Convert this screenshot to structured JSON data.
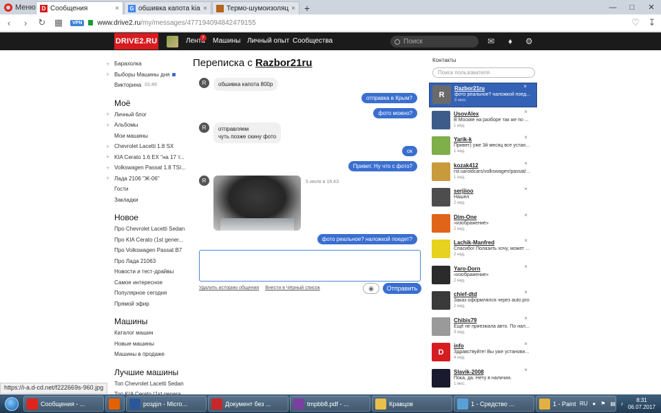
{
  "browser": {
    "menu_label": "Меню",
    "tabs": [
      {
        "label": "Сообщения",
        "active": true,
        "fav_color": "#d71c21",
        "fav_glyph": "D"
      },
      {
        "label": "обшивка капота kia cerato",
        "active": false,
        "fav_color": "#4285f4",
        "fav_glyph": "G"
      },
      {
        "label": "Термо-шумоизоляция ка",
        "active": false,
        "fav_color": "#b5651d",
        "fav_glyph": ""
      }
    ],
    "url_host": "www.drive2.ru",
    "url_path": "/my/messages/4771940948424791​55",
    "vpn_label": "VPN"
  },
  "site": {
    "logo": "DRIVE2.RU",
    "nav": [
      {
        "label": "Лента",
        "badge": "7"
      },
      {
        "label": "Машины"
      },
      {
        "label": "Личный опыт"
      },
      {
        "label": "Сообщества"
      }
    ],
    "search_placeholder": "Поиск"
  },
  "leftnav": {
    "top": [
      {
        "label": "Барахолка",
        "plus": true
      },
      {
        "label": "Выборы Машины дня",
        "plus": true,
        "dot": true
      },
      {
        "label": "Викторина",
        "time": "01:49"
      }
    ],
    "moe_title": "Моё",
    "moe": [
      {
        "label": "Личный блог",
        "plus": true
      },
      {
        "label": "Альбомы",
        "plus": true
      },
      {
        "label": "Мои машины"
      },
      {
        "label": "Chevrolet Lacetti 1.8 SX",
        "plus": true
      },
      {
        "label": "KIA Cerato 1.6 EX \"на 17 т...",
        "plus": true
      },
      {
        "label": "Volkswagen Passat 1.8 TSI...",
        "plus": true
      },
      {
        "label": "Лада 2106 \"Ж-06\"",
        "plus": true
      },
      {
        "label": "Гости"
      },
      {
        "label": "Закладки"
      }
    ],
    "new_title": "Новое",
    "new": [
      {
        "label": "Про Chevrolet Lacetti Sedan"
      },
      {
        "label": "Про KIA Cerato (1st gener..."
      },
      {
        "label": "Про Volkswagen Passat B7"
      },
      {
        "label": "Про Лада 21063"
      },
      {
        "label": "Новости и тест-драйвы"
      },
      {
        "label": "Самое интересное"
      },
      {
        "label": "Популярное сегодня"
      },
      {
        "label": "Прямой эфир"
      }
    ],
    "cars_title": "Машины",
    "cars": [
      {
        "label": "Каталог машин"
      },
      {
        "label": "Новые машины"
      },
      {
        "label": "Машины в продаже"
      }
    ],
    "best_title": "Лучшие машины",
    "best": [
      {
        "label": "Топ Chevrolet Lacetti Sedan"
      },
      {
        "label": "Топ KIA Cerato (1st genera..."
      }
    ]
  },
  "chat": {
    "title_prefix": "Переписка с ",
    "title_user": "Razbor21ru",
    "messages": [
      {
        "dir": "in",
        "text": "обшивка капота 800р"
      },
      {
        "dir": "out",
        "text": "отправка в Крым?"
      },
      {
        "dir": "out",
        "text": "фото можно?"
      },
      {
        "dir": "in",
        "text": "отправляем\nчуть позже скину фото"
      },
      {
        "dir": "out",
        "text": "ок"
      },
      {
        "dir": "out",
        "text": "Привет. Ну что с фото?"
      },
      {
        "dir": "photo",
        "time": "5 июля в 16:43"
      },
      {
        "dir": "out",
        "text": "фото реальное? наложкой поедет?"
      }
    ],
    "avatar_letter": "R",
    "clear_history": "Удалить историю общения",
    "blacklist": "Внести в Чёрный список",
    "send_label": "Отправить"
  },
  "contacts": {
    "title": "Контакты",
    "search_placeholder": "Поиск пользователя",
    "items": [
      {
        "name": "Razbor21ru",
        "msg": "фото реальное? наложкой поед...",
        "time": "8 мин.",
        "color": "#6a6a6a",
        "glyph": "R",
        "active": true
      },
      {
        "name": "UsovAlex",
        "msg": "В Москве на разборе так же по ...",
        "time": "1 нед.",
        "color": "#3d5c8a",
        "glyph": ""
      },
      {
        "name": "Yarik-k",
        "msg": "Привет) уже 3й месяц все устан...",
        "time": "1 нед.",
        "color": "#7fae4a",
        "glyph": ""
      },
      {
        "name": "kozak412",
        "msg": "rst.ua/oldcars/volkswagen/passat/...",
        "time": "1 нед.",
        "color": "#c89a3a",
        "glyph": ""
      },
      {
        "name": "serjiioo",
        "msg": "Нашел",
        "time": "2 нед.",
        "color": "#4d4d4d",
        "glyph": ""
      },
      {
        "name": "Dim-One",
        "msg": "«изображение»",
        "time": "2 нед.",
        "color": "#e0651a",
        "glyph": ""
      },
      {
        "name": "Lachik-Manfred",
        "msg": "Спасибо! Полазить хочу, может ...",
        "time": "2 нед.",
        "color": "#e6d21f",
        "glyph": ""
      },
      {
        "name": "Yaro-Dorn",
        "msg": "«изображение»",
        "time": "2 нед.",
        "color": "#2b2b2b",
        "glyph": ""
      },
      {
        "name": "chief-dtd",
        "msg": "Заказ оформлялся через auto.pro",
        "time": "2 нед.",
        "color": "#3a3a3a",
        "glyph": ""
      },
      {
        "name": "Chibis79",
        "msg": "Ещё не приезжала авто. По нал...",
        "time": "3 нед.",
        "color": "#9a9a9a",
        "glyph": ""
      },
      {
        "name": "info",
        "msg": "Здравствуйте! Вы уже установи...",
        "time": "4 нед.",
        "color": "#d71c21",
        "glyph": "D"
      },
      {
        "name": "Slavik-2008",
        "msg": "Пока, да. Нету в наличии.",
        "time": "1 мес.",
        "color": "#1a1a2e",
        "glyph": ""
      }
    ]
  },
  "status_url": "https://i-a.d-cd.net/f222669s-960.jpg",
  "taskbar": {
    "items": [
      {
        "label": "Сообщения - ...",
        "color": "#e2231a"
      },
      {
        "label": "",
        "color": "#e66000"
      },
      {
        "label": "розділ - Micro...",
        "color": "#2b579a"
      },
      {
        "label": "Документ без ...",
        "color": "#c8282a"
      },
      {
        "label": "tmpbb8.pdf - ...",
        "color": "#7b3fa0"
      },
      {
        "label": "Кравцов",
        "color": "#e8c04a"
      },
      {
        "label": "1 - Средство ...",
        "color": "#5aa0d8"
      },
      {
        "label": "1 - Paint",
        "color": "#e2b140"
      }
    ],
    "lang": "RU",
    "time": "8:31",
    "date": "06.07.2017"
  }
}
